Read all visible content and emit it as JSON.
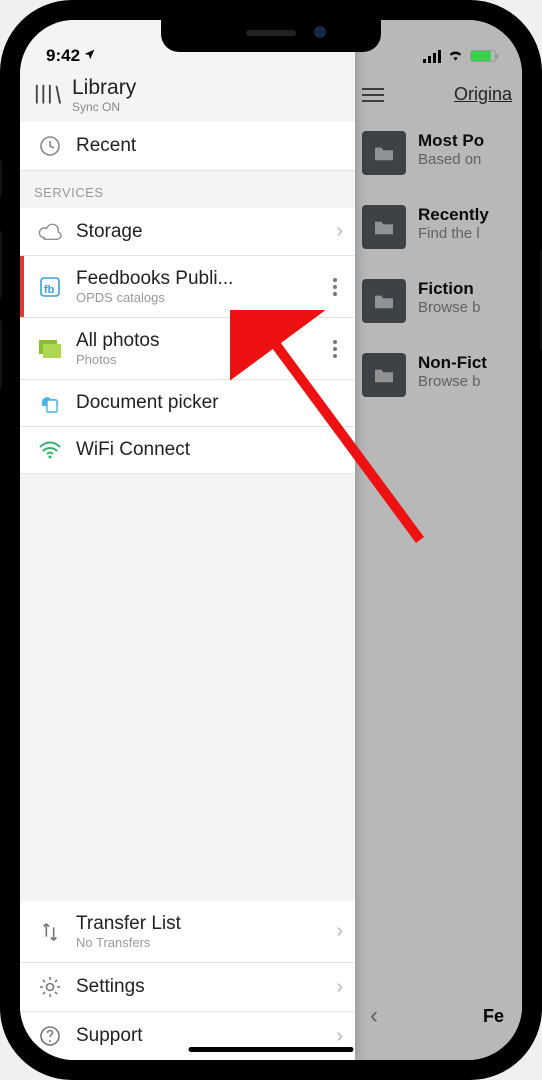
{
  "status": {
    "time": "9:42"
  },
  "drawer": {
    "header_title": "Library",
    "header_sub": "Sync ON",
    "recent": {
      "label": "Recent"
    },
    "services_label": "SERVICES",
    "storage": {
      "label": "Storage"
    },
    "feedbooks": {
      "title": "Feedbooks Publi...",
      "sub": "OPDS catalogs"
    },
    "allphotos": {
      "title": "All photos",
      "sub": "Photos"
    },
    "docpicker": {
      "label": "Document picker"
    },
    "wifi": {
      "label": "WiFi Connect"
    },
    "transfer": {
      "title": "Transfer List",
      "sub": "No Transfers"
    },
    "settings": {
      "label": "Settings"
    },
    "support": {
      "label": "Support"
    }
  },
  "bg": {
    "nav_link": "Origina",
    "items": [
      {
        "title": "Most Po",
        "sub": "Based on"
      },
      {
        "title": "Recently",
        "sub": "Find the l"
      },
      {
        "title": "Fiction",
        "sub": "Browse b"
      },
      {
        "title": "Non-Fict",
        "sub": "Browse b"
      }
    ],
    "bottom_text": "Fe"
  }
}
